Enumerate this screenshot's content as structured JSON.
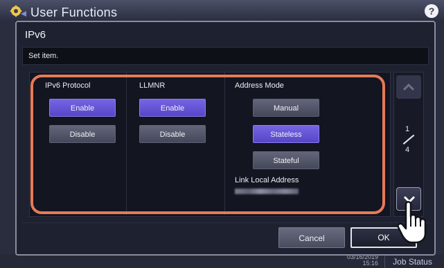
{
  "app": {
    "title": "User Functions"
  },
  "dialog": {
    "title": "IPv6",
    "subtitle": "Set item.",
    "columns": [
      {
        "label": "IPv6 Protocol",
        "options": [
          "Enable",
          "Disable"
        ],
        "selected": "Enable"
      },
      {
        "label": "LLMNR",
        "options": [
          "Enable",
          "Disable"
        ],
        "selected": "Enable"
      },
      {
        "label": "Address Mode",
        "options": [
          "Manual",
          "Stateless",
          "Stateful"
        ],
        "selected": "Stateless"
      }
    ],
    "link_local_label": "Link Local Address",
    "page": {
      "current": "1",
      "total": "4"
    },
    "cancel_label": "Cancel",
    "ok_label": "OK"
  },
  "status": {
    "date": "03/16/2019",
    "time": "15:16",
    "job_status_label": "Job Status"
  },
  "colors": {
    "accent": "#6757d9",
    "highlight": "#e77a58"
  }
}
